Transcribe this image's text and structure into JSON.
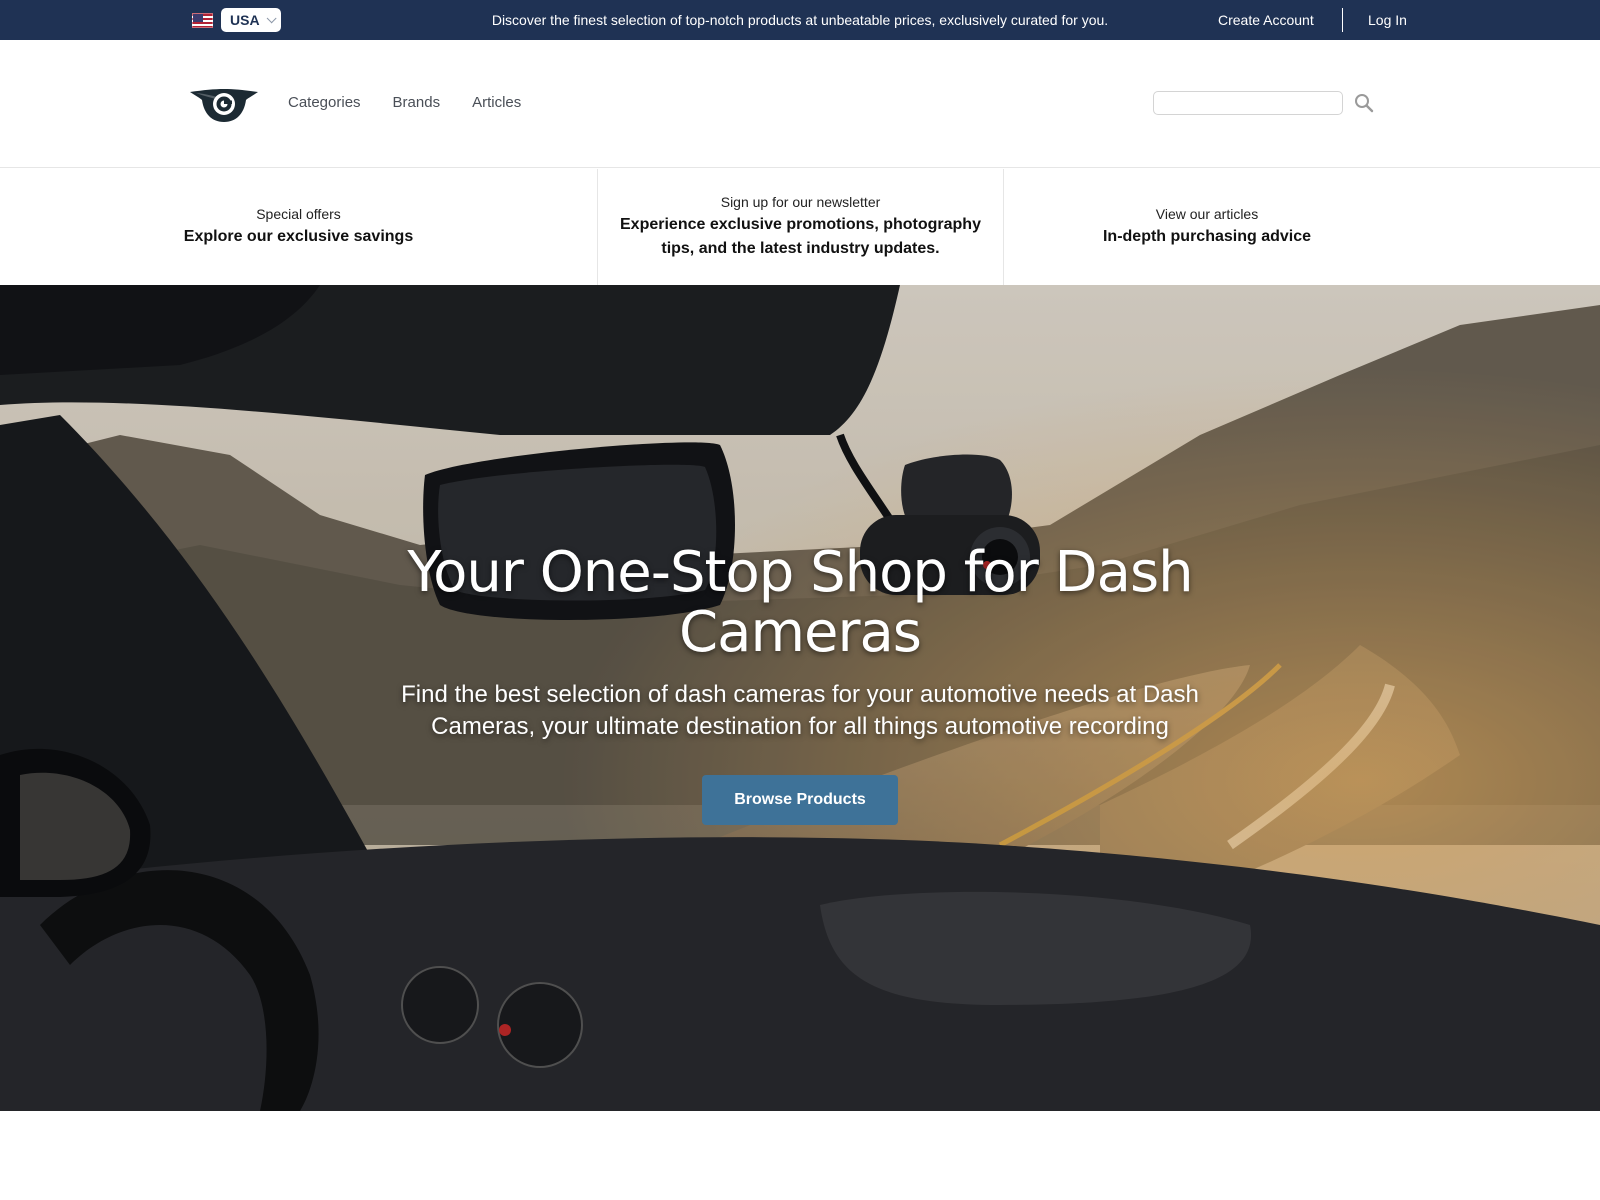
{
  "topbar": {
    "locale": {
      "flag": "us-flag-icon",
      "selected": "USA"
    },
    "announcement": "Discover the finest selection of top-notch products at unbeatable prices, exclusively curated for you.",
    "create_account": "Create Account",
    "log_in": "Log In",
    "background": "#1f3254"
  },
  "header": {
    "logo": "winged-eye-logo",
    "nav": [
      "Categories",
      "Brands",
      "Articles"
    ],
    "search": {
      "value": "",
      "placeholder": "",
      "icon": "search-icon"
    }
  },
  "promos": [
    {
      "kicker": "Special offers",
      "headline": "Explore our exclusive savings"
    },
    {
      "kicker": "Sign up for our newsletter",
      "headline": "Experience exclusive promotions, photography tips, and the latest industry updates."
    },
    {
      "kicker": "View our articles",
      "headline": "In-depth purchasing advice"
    }
  ],
  "hero": {
    "title": "Your One-Stop Shop for Dash Cameras",
    "subtitle": "Find the best selection of dash cameras for your automotive needs at Dash Cameras, your ultimate destination for all things automotive recording",
    "cta": "Browse Products",
    "cta_color": "#3e7298"
  }
}
